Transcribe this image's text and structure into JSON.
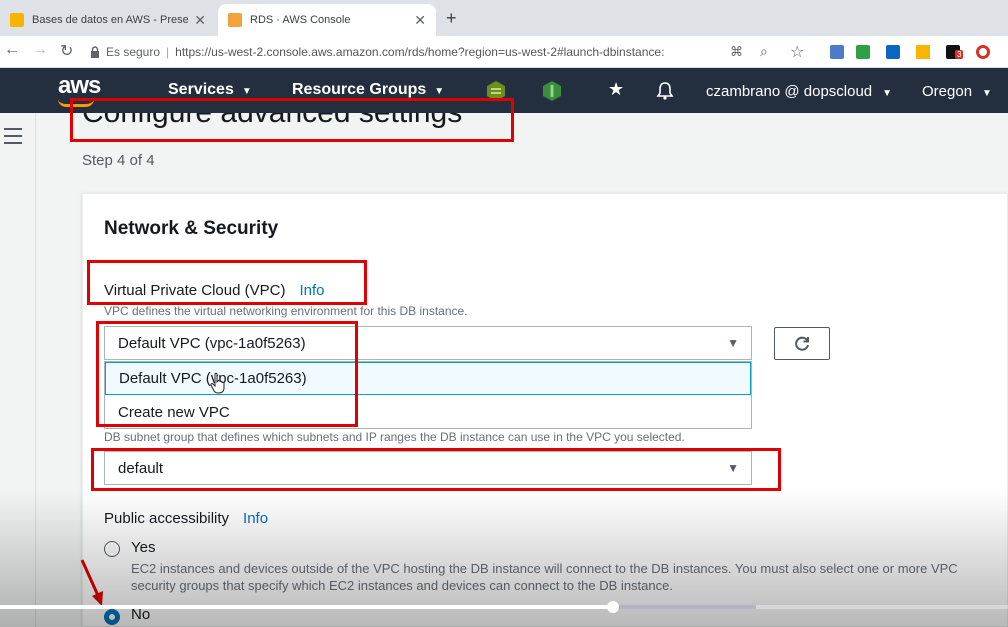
{
  "browser": {
    "tabs": [
      {
        "title": "Bases de datos en AWS - Presen…",
        "favicon_color": "#f4b400"
      },
      {
        "title": "RDS · AWS Console",
        "favicon_color": "#f2a33a"
      }
    ],
    "new_tab": "+",
    "secure_label": "Es seguro",
    "url": "https://us-west-2.console.aws.amazon.com/rds/home?region=us-west-2#launch-dbinstance:",
    "extension_badge": "3"
  },
  "aws_nav": {
    "logo": "aws",
    "services": "Services",
    "resource_groups": "Resource Groups",
    "user": "czambrano @ dopscloud",
    "region": "Oregon"
  },
  "page": {
    "heading": "Configure advanced settings",
    "step": "Step 4 of 4"
  },
  "network": {
    "title": "Network & Security",
    "vpc_label": "Virtual Private Cloud (VPC)",
    "info": "Info",
    "vpc_desc": "VPC defines the virtual networking environment for this DB instance.",
    "vpc_selected": "Default VPC (vpc-1a0f5263)",
    "vpc_options": [
      "Default VPC (vpc-1a0f5263)",
      "Create new VPC"
    ],
    "subnet_desc": "DB subnet group that defines which subnets and IP ranges the DB instance can use in the VPC you selected.",
    "subnet_selected": "default",
    "public_label": "Public accessibility",
    "public_info": "Info",
    "yes_label": "Yes",
    "yes_desc": "EC2 instances and devices outside of the VPC hosting the DB instance will connect to the DB instances. You must also select one or more VPC security groups that specify which EC2 instances and devices can connect to the DB instance.",
    "no_label": "No",
    "public_selected": "No"
  },
  "video": {
    "played_fraction": 0.608,
    "buffered_fraction": 0.75
  },
  "colors": {
    "aws_nav": "#232f3e",
    "aws_orange": "#ff9900",
    "link": "#0073bb",
    "annotation_red": "#e00000"
  }
}
